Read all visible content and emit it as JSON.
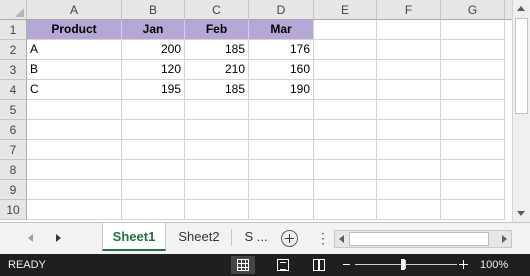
{
  "columns": [
    "A",
    "B",
    "C",
    "D",
    "E",
    "F",
    "G"
  ],
  "rows": [
    "1",
    "2",
    "3",
    "4",
    "5",
    "6",
    "7",
    "8",
    "9",
    "10"
  ],
  "cells": {
    "A1": "Product",
    "B1": "Jan",
    "C1": "Feb",
    "D1": "Mar",
    "A2": "A",
    "B2": "200",
    "C2": "185",
    "D2": "176",
    "A3": "B",
    "B3": "120",
    "C3": "210",
    "D3": "160",
    "A4": "C",
    "B4": "195",
    "C4": "185",
    "D4": "190"
  },
  "header_fill_color": "#b4a7d6",
  "sheet_tabs": [
    {
      "label": "Sheet1",
      "active": true
    },
    {
      "label": "Sheet2",
      "active": false
    },
    {
      "label": "S ...",
      "active": false
    }
  ],
  "status": {
    "ready_text": "READY",
    "zoom_text": "100%",
    "zoom_percent": 100,
    "active_view": "normal"
  },
  "accent_color": "#217346",
  "icons": [
    "add-sheet-icon",
    "tab-scroll-left-icon",
    "tab-scroll-right-icon",
    "normal-view-icon",
    "page-layout-view-icon",
    "page-break-preview-icon",
    "zoom-out-icon",
    "zoom-in-icon"
  ]
}
